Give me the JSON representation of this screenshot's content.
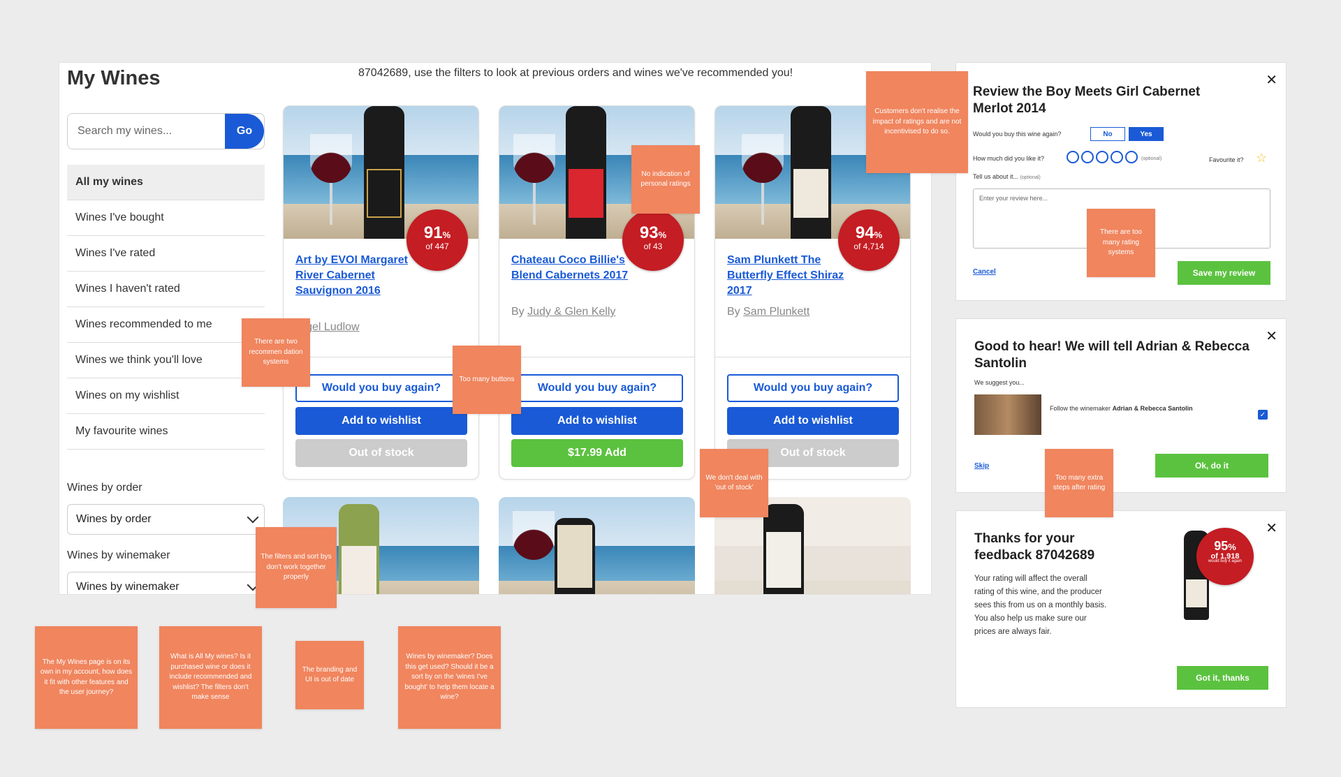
{
  "page": {
    "title": "My Wines",
    "welcome": "87042689, use the filters to look at previous orders and wines we've recommended you!"
  },
  "search": {
    "placeholder": "Search my wines...",
    "go_label": "Go"
  },
  "sidebar": {
    "items": [
      {
        "label": "All my wines"
      },
      {
        "label": "Wines I've bought"
      },
      {
        "label": "Wines I've rated"
      },
      {
        "label": "Wines I haven't rated"
      },
      {
        "label": "Wines recommended to me"
      },
      {
        "label": "Wines we think you'll love"
      },
      {
        "label": "Wines on my wishlist"
      },
      {
        "label": "My favourite wines"
      }
    ]
  },
  "filters": {
    "order_label": "Wines by order",
    "order_value": "Wines by order",
    "winemaker_label": "Wines by winemaker",
    "winemaker_value": "Wines by winemaker"
  },
  "cards": [
    {
      "name": "Art by EVOI Margaret River Cabernet Sauvignon 2016",
      "by": "Nigel Ludlow",
      "pct": "91",
      "count": "of 447",
      "buy_again": "Would you buy again?",
      "wishlist": "Add to wishlist",
      "action": "Out of stock"
    },
    {
      "name": "Chateau Coco Billie's Blend Cabernets 2017",
      "by_prefix": "By",
      "by": "Judy & Glen Kelly",
      "pct": "93",
      "count": "of 43",
      "buy_again": "Would you buy again?",
      "wishlist": "Add to wishlist",
      "action": "$17.99 Add"
    },
    {
      "name": "Sam Plunkett The Butterfly Effect Shiraz 2017",
      "by_prefix": "By",
      "by": "Sam Plunkett",
      "pct": "94",
      "count": "of 4,714",
      "buy_again": "Would you buy again?",
      "wishlist": "Add to wishlist",
      "action": "Out of stock"
    }
  ],
  "pct_symbol": "%",
  "review_panel": {
    "title": "Review the Boy Meets Girl Cabernet Merlot 2014",
    "q_buy": "Would you buy this wine again?",
    "no": "No",
    "yes": "Yes",
    "q_like": "How much did you like it?",
    "optional": "(optional)",
    "favourite": "Favourite it?",
    "tell": "Tell us about it...",
    "tell_optional": "(optional)",
    "placeholder": "Enter your review here...",
    "cancel": "Cancel",
    "save": "Save my review"
  },
  "good_panel": {
    "title": "Good to hear! We will tell Adrian & Rebecca Santolin",
    "suggest": "We suggest you...",
    "follow_text": "Follow the winemaker",
    "follow_name": "Adrian & Rebecca Santolin",
    "skip": "Skip",
    "ok": "Ok, do it"
  },
  "thanks_panel": {
    "title": "Thanks for your feedback 87042689",
    "body": "Your rating will affect the overall rating of this wine, and the producer sees this from us on a monthly basis. You also help us make sure our prices are always fair.",
    "pct": "95",
    "count": "of 1,918",
    "sub": "would buy it again",
    "got_it": "Got it, thanks"
  },
  "notes": {
    "customers": "Customers don't realise the impact of ratings and are not incentivised to do so.",
    "no_indication": "No indication of personal ratings",
    "two_reco": "There are two recommen dation systems",
    "too_many_buttons": "Too many buttons",
    "many_ratings": "There are too many rating systems",
    "out_of_stock": "We don't deal with 'out of stock'",
    "filters": "The filters and sort bys don't work together properly",
    "extra_steps": "Too many extra steps after rating",
    "my_wines_page": "The My Wines page is on its own in my account, how does it fit with other features and the user journey?",
    "all_my_wines": "What is All My wines? Is it purchased wine or does it include recommended and wishlist? The filters don't make sense",
    "branding": "The branding and UI is out of date",
    "by_winemaker": "Wines by winemaker? Does this get used? Should it be a sort by on the 'wines I've bought' to help them locate a wine?"
  },
  "colors": {
    "accent": "#1a5ad6",
    "green": "#5bc23f",
    "badge_red": "#c41d23",
    "sticky": "#f0855e"
  }
}
